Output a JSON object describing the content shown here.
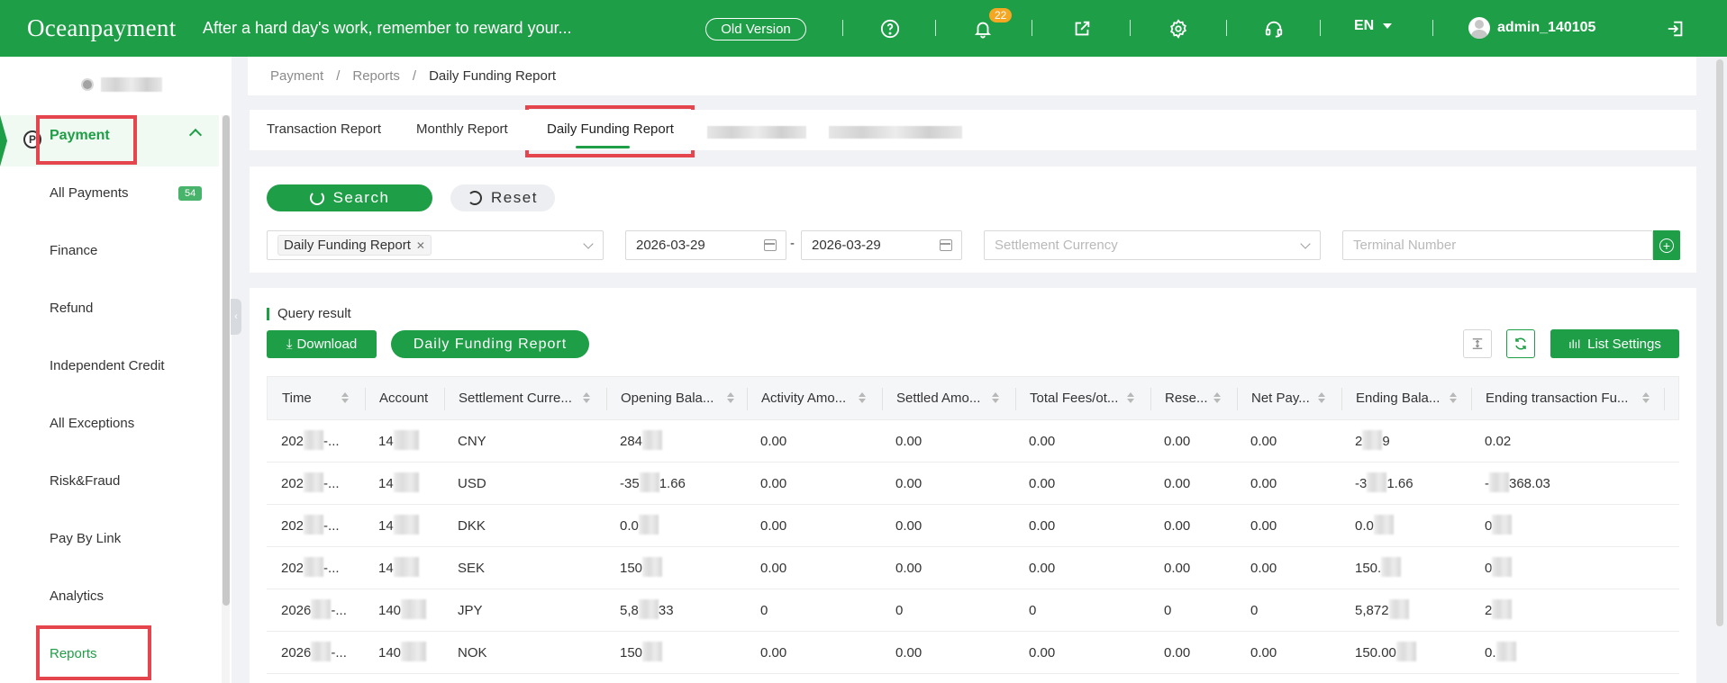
{
  "header": {
    "logo": "Oceanpayment",
    "slogan": "After a hard day's work, remember to reward your...",
    "old_version": "Old Version",
    "notification_count": "22",
    "language": "EN",
    "user": "admin_140105"
  },
  "sidebar": {
    "parent": "Payment",
    "items": [
      {
        "label": "All Payments",
        "badge": "54"
      },
      {
        "label": "Finance"
      },
      {
        "label": "Refund"
      },
      {
        "label": "Independent Credit"
      },
      {
        "label": "All Exceptions"
      },
      {
        "label": "Risk&Fraud"
      },
      {
        "label": "Pay By Link"
      },
      {
        "label": "Analytics"
      },
      {
        "label": "Reports"
      }
    ]
  },
  "breadcrumb": [
    "Payment",
    "/",
    "Reports",
    "/",
    "Daily Funding Report"
  ],
  "tabs": [
    "Transaction Report",
    "Monthly Report",
    "Daily Funding Report"
  ],
  "filters": {
    "search_label": "Search",
    "reset_label": "Reset",
    "report_type_tag": "Daily Funding Report",
    "date_start": "2026-03-29",
    "date_sep": "-",
    "date_end": "2026-03-29",
    "currency_placeholder": "Settlement Currency",
    "terminal_placeholder": "Terminal Number"
  },
  "result": {
    "title": "Query result",
    "download_label": "Download",
    "report_button": "Daily Funding Report",
    "list_settings": "List Settings"
  },
  "table": {
    "columns": [
      "Time",
      "Account",
      "Settlement Curre...",
      "Opening Bala...",
      "Activity Amo...",
      "Settled Amo...",
      "Total Fees/ot...",
      "Rese...",
      "Net Pay...",
      "Ending Bala...",
      "Ending transaction Fu..."
    ],
    "rows": [
      [
        "202",
        "-...",
        "14",
        "CNY",
        "284",
        "0.00",
        "0.00",
        "0.00",
        "0.00",
        "0.00",
        "2",
        "9",
        "0.02"
      ],
      [
        "202",
        "-...",
        "14",
        "USD",
        "-35",
        "1.66",
        "0.00",
        "0.00",
        "0.00",
        "0.00",
        "0.00",
        "-3",
        "1.66",
        "-",
        "368.03"
      ],
      [
        "202",
        "-...",
        "14",
        "DKK",
        "0.0",
        "0.00",
        "0.00",
        "0.00",
        "0.00",
        "0.00",
        "0.0",
        "0"
      ],
      [
        "202",
        "-...",
        "14",
        "SEK",
        "150",
        "0.00",
        "0.00",
        "0.00",
        "0.00",
        "0.00",
        "150.",
        "0"
      ],
      [
        "2026",
        "-...",
        "140",
        "JPY",
        "5,8",
        "33",
        "0",
        "0",
        "0",
        "0",
        "0",
        "5,872",
        "2"
      ],
      [
        "2026",
        "-...",
        "140",
        "NOK",
        "150",
        "0.00",
        "0.00",
        "0.00",
        "0.00",
        "0.00",
        "150.00",
        "0."
      ]
    ]
  },
  "colors": {
    "brand": "#1e9e46",
    "highlight": "#e5464d"
  }
}
